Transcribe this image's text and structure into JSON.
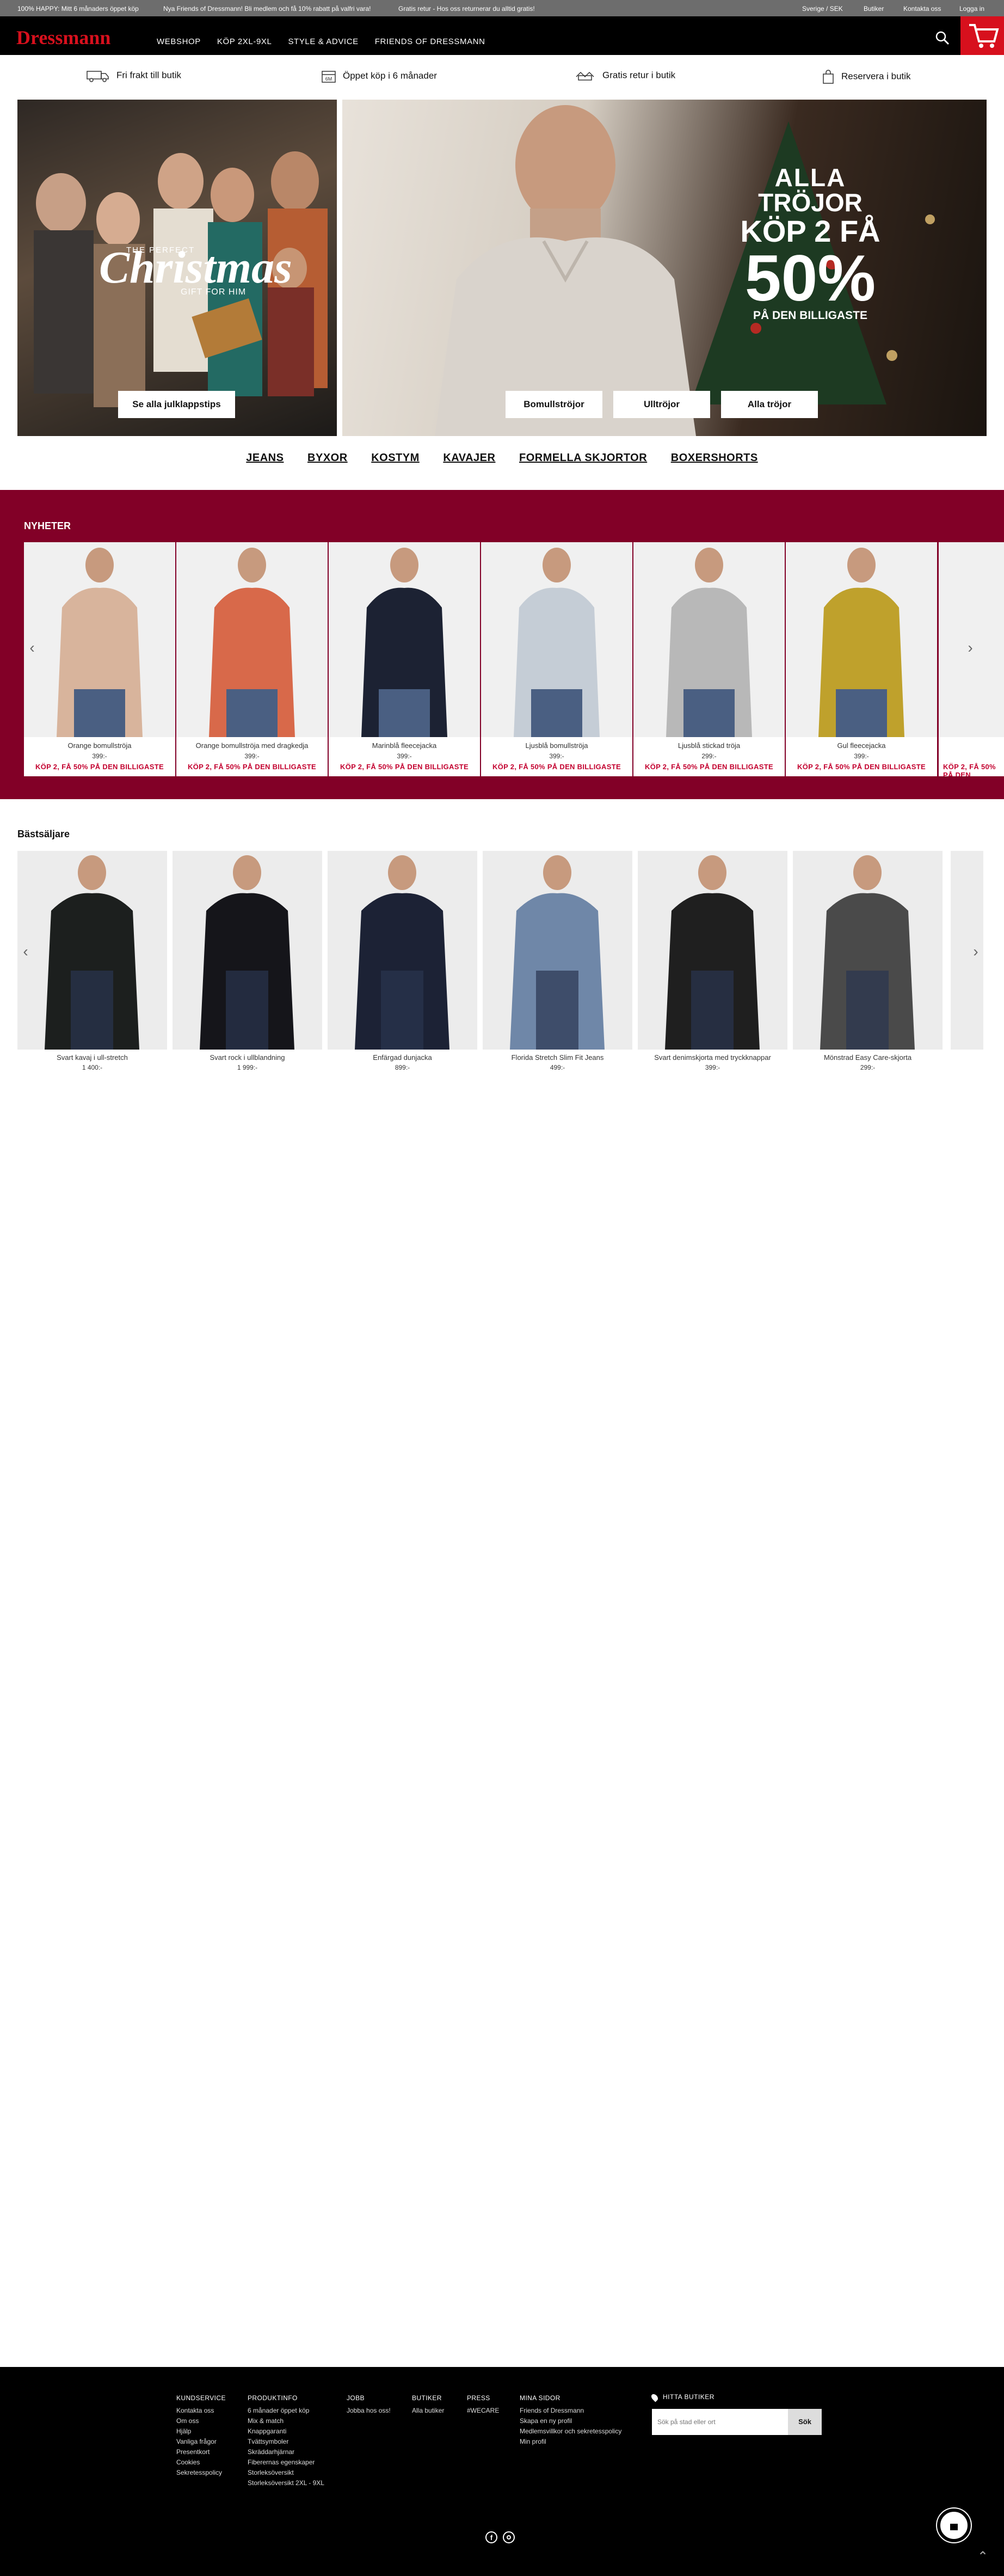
{
  "topbar": {
    "left1": "100% HAPPY: Mitt 6 månaders öppet köp",
    "left2": "Nya Friends of Dressmann! Bli medlem och få 10% rabatt på valfri vara!",
    "left3": "Gratis retur - Hos oss returnerar du alltid gratis!",
    "region": "Sverige / SEK",
    "stores": "Butiker",
    "contact": "Kontakta oss",
    "login": "Logga in"
  },
  "nav": {
    "logo": "Dressmann",
    "links": [
      "WEBSHOP",
      "KÖP 2XL-9XL",
      "STYLE & ADVICE",
      "FRIENDS OF DRESSMANN"
    ]
  },
  "usps": [
    "Fri frakt till butik",
    "Öppet köp i 6 månader",
    "Gratis retur i butik",
    "Reservera i butik"
  ],
  "hero_left": {
    "script_title": "Christmas",
    "sub1": "THE PERFECT",
    "sub2": "GIFT FOR HIM",
    "button": "Se alla julklappstips"
  },
  "hero_right": {
    "l1": "ALLA",
    "l2": "TRÖJOR",
    "l3": "KÖP 2 FÅ",
    "l4": "50%",
    "l5": "PÅ DEN BILLIGASTE",
    "buttons": [
      "Bomullströjor",
      "Ulltröjor",
      "Alla tröjor"
    ]
  },
  "categories": [
    "JEANS",
    "BYXOR",
    "KOSTYM",
    "KAVAJER",
    "FORMELLA SKJORTOR",
    "BOXERSHORTS"
  ],
  "news": {
    "title": "NYHETER",
    "campaign": "KÖP 2, FÅ 50% PÅ DEN BILLIGASTE",
    "items": [
      {
        "name": "Orange bomullströja",
        "price": "399:-",
        "color": "#d8b49c"
      },
      {
        "name": "Orange bomullströja med dragkedja",
        "price": "399:-",
        "color": "#d8694a"
      },
      {
        "name": "Marinblå fleecejacka",
        "price": "399:-",
        "color": "#1c2233"
      },
      {
        "name": "Ljusblå bomullströja",
        "price": "399:-",
        "color": "#c5cdd6"
      },
      {
        "name": "Ljusblå stickad tröja",
        "price": "299:-",
        "color": "#b8b8b8"
      },
      {
        "name": "Gul fleecejacka",
        "price": "399:-",
        "color": "#bfa12c"
      }
    ]
  },
  "bestsellers": {
    "title": "Bästsäljare",
    "items": [
      {
        "name": "Svart kavaj i ull-stretch",
        "price": "1 400:-",
        "color": "#1c1f1e"
      },
      {
        "name": "Svart rock i ullblandning",
        "price": "1 999:-",
        "color": "#15151a"
      },
      {
        "name": "Enfärgad dunjacka",
        "price": "899:-",
        "color": "#1c2235"
      },
      {
        "name": "Florida Stretch Slim Fit Jeans",
        "price": "499:-",
        "color": "#6f87a8"
      },
      {
        "name": "Svart denimskjorta med tryckknappar",
        "price": "399:-",
        "color": "#1f1f1f"
      },
      {
        "name": "Mönstrad Easy Care-skjorta",
        "price": "299:-",
        "color": "#4a4a4a"
      }
    ]
  },
  "footer": {
    "cols": [
      {
        "title": "KUNDSERVICE",
        "links": [
          "Kontakta oss",
          "Om oss",
          "Hjälp",
          "Vanliga frågor",
          "Presentkort",
          "Cookies",
          "Sekretesspolicy"
        ]
      },
      {
        "title": "PRODUKTINFO",
        "links": [
          "6 månader öppet köp",
          "Mix & match",
          "Knappgaranti",
          "Tvättsymboler",
          "Skräddarhjärnar",
          "Fiberernas egenskaper",
          "Storleksöversikt",
          "Storleksöversikt 2XL - 9XL"
        ]
      },
      {
        "title": "JOBB",
        "links": [
          "Jobba hos oss!"
        ]
      },
      {
        "title": "BUTIKER",
        "links": [
          "Alla butiker"
        ]
      },
      {
        "title": "PRESS",
        "links": [
          "#WECARE"
        ]
      },
      {
        "title": "MINA SIDOR",
        "links": [
          "Friends of Dressmann",
          "Skapa en ny profil",
          "Medlemsvillkor och sekretesspolicy",
          "Min profil"
        ]
      }
    ],
    "find_store": "HITTA BUTIKER",
    "search_placeholder": "Sök på stad eller ort",
    "search_button": "Sök"
  }
}
